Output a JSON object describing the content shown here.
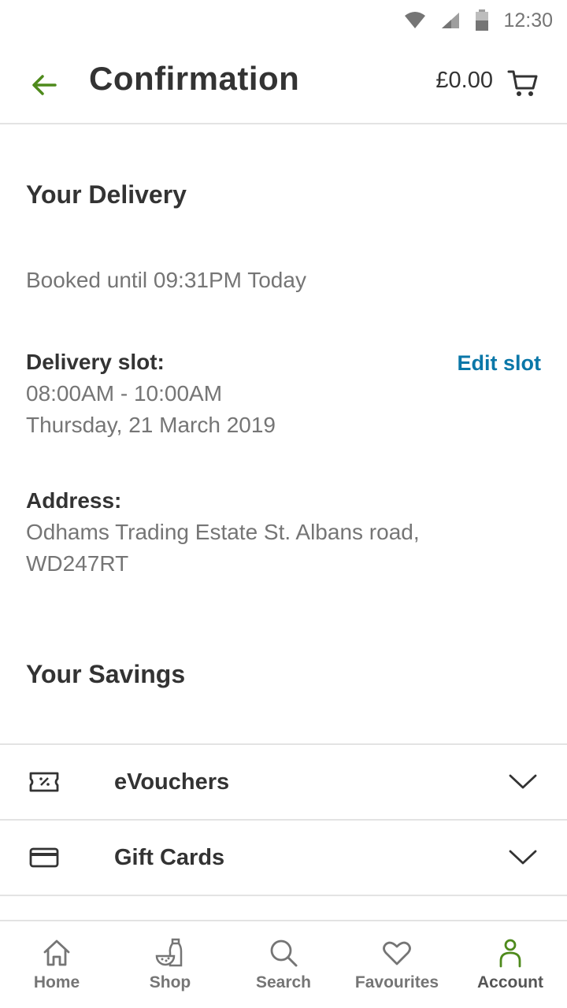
{
  "status_bar": {
    "time": "12:30"
  },
  "header": {
    "title": "Confirmation",
    "cart_total": "£0.00"
  },
  "delivery": {
    "section_title": "Your Delivery",
    "booked_text": "Booked until 09:31PM Today",
    "slot_label": "Delivery slot:",
    "slot_time": "08:00AM - 10:00AM",
    "slot_date": "Thursday, 21 March 2019",
    "edit_slot_label": "Edit slot",
    "address_label": "Address:",
    "address_line1": "Odhams Trading Estate St. Albans road,",
    "address_line2": "WD247RT"
  },
  "savings": {
    "section_title": "Your Savings",
    "items": [
      {
        "label": "eVouchers",
        "icon": "voucher-icon"
      },
      {
        "label": "Gift Cards",
        "icon": "card-icon"
      }
    ]
  },
  "bottom_nav": {
    "items": [
      {
        "label": "Home",
        "icon": "home-icon"
      },
      {
        "label": "Shop",
        "icon": "shop-icon"
      },
      {
        "label": "Search",
        "icon": "search-icon"
      },
      {
        "label": "Favourites",
        "icon": "heart-icon"
      },
      {
        "label": "Account",
        "icon": "account-icon"
      }
    ],
    "active": "Account"
  },
  "colors": {
    "accent_green": "#4e8a1c",
    "link_blue": "#0a77a8",
    "text_dark": "#333333",
    "text_muted": "#757575"
  }
}
